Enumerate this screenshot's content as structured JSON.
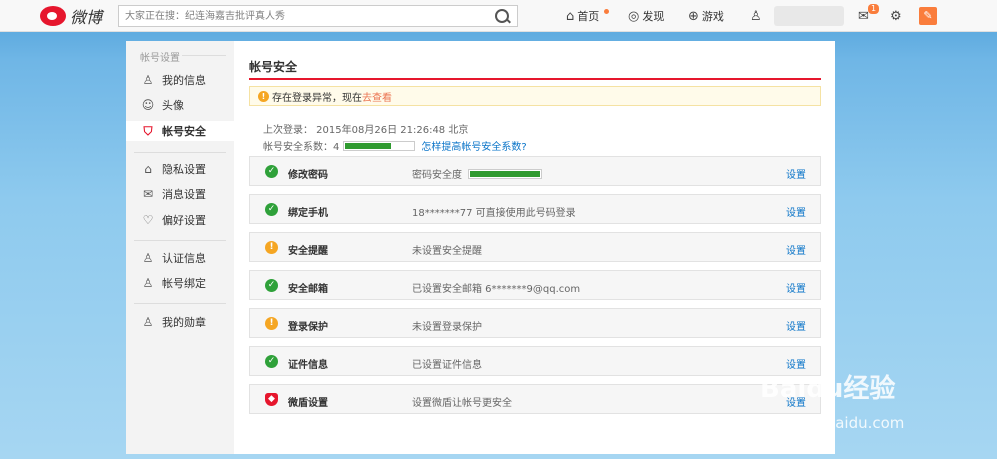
{
  "app": {
    "logo_text": "微博"
  },
  "search": {
    "placeholder": "大家正在搜：纪连海嘉吉批评真人秀"
  },
  "nav": {
    "home": "首页",
    "discover": "发现",
    "game": "游戏",
    "msg_badge": "1"
  },
  "sidebar": {
    "section_title": "帐号设置",
    "items": [
      {
        "label": "我的信息",
        "icon": "user-icon"
      },
      {
        "label": "头像",
        "icon": "avatar-icon"
      },
      {
        "label": "帐号安全",
        "icon": "shield-icon"
      },
      {
        "label": "隐私设置",
        "icon": "lock-icon"
      },
      {
        "label": "消息设置",
        "icon": "message-icon"
      },
      {
        "label": "偏好设置",
        "icon": "heart-icon"
      },
      {
        "label": "认证信息",
        "icon": "verify-icon"
      },
      {
        "label": "帐号绑定",
        "icon": "bind-icon"
      },
      {
        "label": "我的勋章",
        "icon": "medal-icon"
      }
    ]
  },
  "main": {
    "title": "帐号安全",
    "alert": {
      "text": "存在登录异常，现在",
      "link": "去查看"
    },
    "last_login": "上次登录： 2015年08月26日  21:26:48  北京",
    "score_label": "帐号安全系数：4",
    "score_fraction": 0.68,
    "score_link": "怎样提高帐号安全系数?",
    "rows": [
      {
        "name": "修改密码",
        "desc": "密码安全度",
        "status": "ok",
        "strength_fraction": 1.0,
        "action": "设置"
      },
      {
        "name": "绑定手机",
        "desc": "18*******77 可直接使用此号码登录",
        "status": "ok",
        "action": "设置"
      },
      {
        "name": "安全提醒",
        "desc": "未设置安全提醒",
        "status": "warn",
        "action": "设置"
      },
      {
        "name": "安全邮箱",
        "desc": "已设置安全邮箱 6*******9@qq.com",
        "status": "ok",
        "action": "设置"
      },
      {
        "name": "登录保护",
        "desc": "未设置登录保护",
        "status": "warn",
        "action": "设置"
      },
      {
        "name": "证件信息",
        "desc": "已设置证件信息",
        "status": "ok",
        "action": "设置"
      },
      {
        "name": "微盾设置",
        "desc": "设置微盾让帐号更安全",
        "status": "shield",
        "action": "设置"
      }
    ]
  },
  "watermark": {
    "text": "Baidu经验",
    "sub": "jingyan.baidu.com"
  }
}
